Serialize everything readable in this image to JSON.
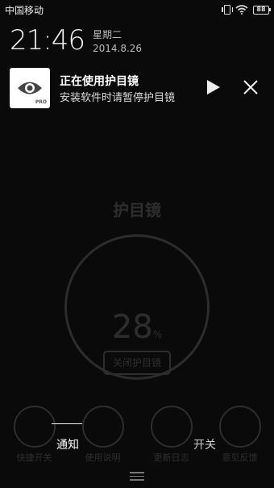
{
  "status_bar": {
    "carrier": "中国移动",
    "battery": "88"
  },
  "clock": {
    "time": "21:46",
    "weekday": "星期二",
    "date": "2014.8.26"
  },
  "notification": {
    "icon_badge": "PRO",
    "title": "正在使用护目镜",
    "text": "安装软件时请暂停护目镜"
  },
  "background_app": {
    "title": "护目镜",
    "gauge_value": "28",
    "gauge_unit": "%",
    "toggle_button": "关闭护目镜",
    "nav": [
      "快捷开关",
      "使用说明",
      "更新日志",
      "意见反馈"
    ]
  },
  "drawer_tabs": {
    "notify": "通知",
    "switch": "开关"
  },
  "colors": {
    "background": "#0a0a0a",
    "text": "#ffffff",
    "subtext": "#bbbbbb"
  }
}
